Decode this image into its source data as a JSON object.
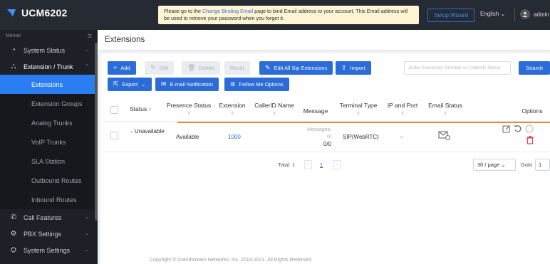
{
  "app": {
    "name": "UCM6202"
  },
  "notice": {
    "before": "Please go to the ",
    "link": "Change Binding Email",
    "after": " page to bind Email address to your account. This Email address will be used to retrieve your password when you forget it."
  },
  "header": {
    "setup_wizard": "Setup Wizard",
    "language": "English",
    "user": "admin"
  },
  "sidebar": {
    "menus_label": "Menus",
    "items": [
      {
        "label": "System Status",
        "icon": "dashboard-icon"
      },
      {
        "label": "Extension / Trunk",
        "icon": "extension-trunk-icon"
      },
      {
        "label": "Call Features",
        "icon": "phone-icon"
      },
      {
        "label": "PBX Settings",
        "icon": "gear-icon"
      },
      {
        "label": "System Settings",
        "icon": "system-settings-icon"
      }
    ],
    "subitems": [
      "Extensions",
      "Extension Groups",
      "Analog Trunks",
      "VoIP Trunks",
      "SLA Station",
      "Outbound Routes",
      "Inbound Routes"
    ]
  },
  "page": {
    "title": "Extensions"
  },
  "toolbar": {
    "add": "Add",
    "edit": "Edit",
    "delete": "Delete",
    "reset": "Reset",
    "edit_all": "Edit All Sip Extensions",
    "import": "Import",
    "export": "Export",
    "email_notification": "E-mail Notification",
    "follow_me": "Follow Me Options",
    "search_placeholder": "Enter Extension Number or CallerID Name",
    "search": "Search"
  },
  "table": {
    "columns": {
      "status": "Status",
      "presence": "Presence Status",
      "extension": "Extension",
      "callerid": "CallerID Name",
      "message": "Message",
      "terminal": "Terminal Type",
      "ip_port": "IP and Port",
      "email_status": "Email Status",
      "options": "Options"
    },
    "rows": [
      {
        "status": "Unavailable",
        "presence": "Available",
        "extension": "1000",
        "callerid": "",
        "message_label": "Messages: 0/",
        "message_value": "0/0",
        "terminal": "SIP(WebRTC)",
        "ip_port": "--"
      }
    ]
  },
  "pagination": {
    "total_label": "Total: 1",
    "current_page": "1",
    "page_size": "30 / page",
    "goto_label": "Goto",
    "goto_value": "1"
  },
  "footer": "Copyright © Grandstream Networks, Inc. 2014-2021. All Rights Reserved.",
  "colors": {
    "accent": "#2b6cd8",
    "sidebar_active": "#2b7ef2",
    "delete": "#e04b4b",
    "highlight_line": "#e98a2c"
  }
}
